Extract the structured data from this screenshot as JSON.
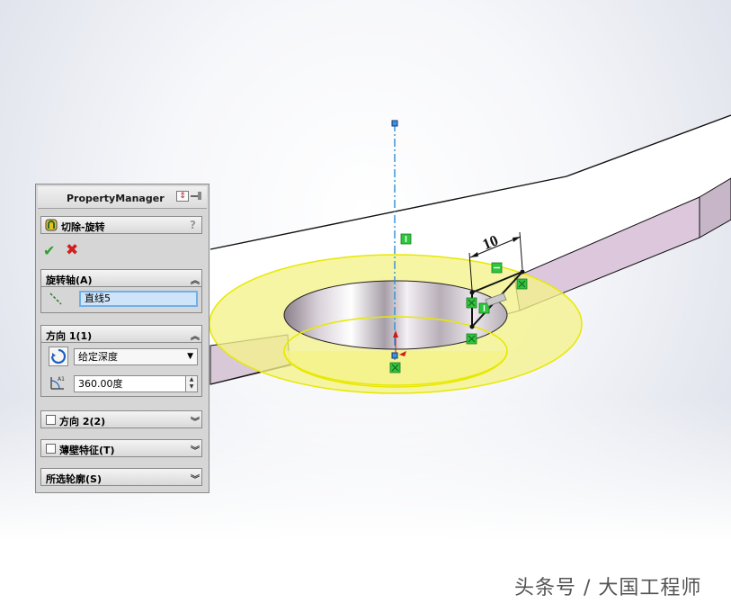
{
  "property_manager": {
    "header_title": "PropertyManager",
    "feature_title": "切除-旋转",
    "help_icon": "?",
    "ok_icon": "✔",
    "cancel_icon": "✖",
    "axis_section": {
      "label": "旋转轴(A)",
      "selected": "直线5"
    },
    "direction1": {
      "label": "方向 1(1)",
      "end_condition": "给定深度",
      "angle": "360.00度"
    },
    "direction2": {
      "label": "方向 2(2)"
    },
    "thin_feature": {
      "label": "薄壁特征(T)"
    },
    "selected_contours": {
      "label": "所选轮廓(S)"
    }
  },
  "viewport": {
    "dimension_value": "10",
    "colors": {
      "preview_yellow": "#f3f28a",
      "side_face": "#dcc7dc",
      "axis_line": "#2a8fd8",
      "relation_green": "#2dc63c"
    }
  },
  "watermark": "头条号 / 大国工程师"
}
